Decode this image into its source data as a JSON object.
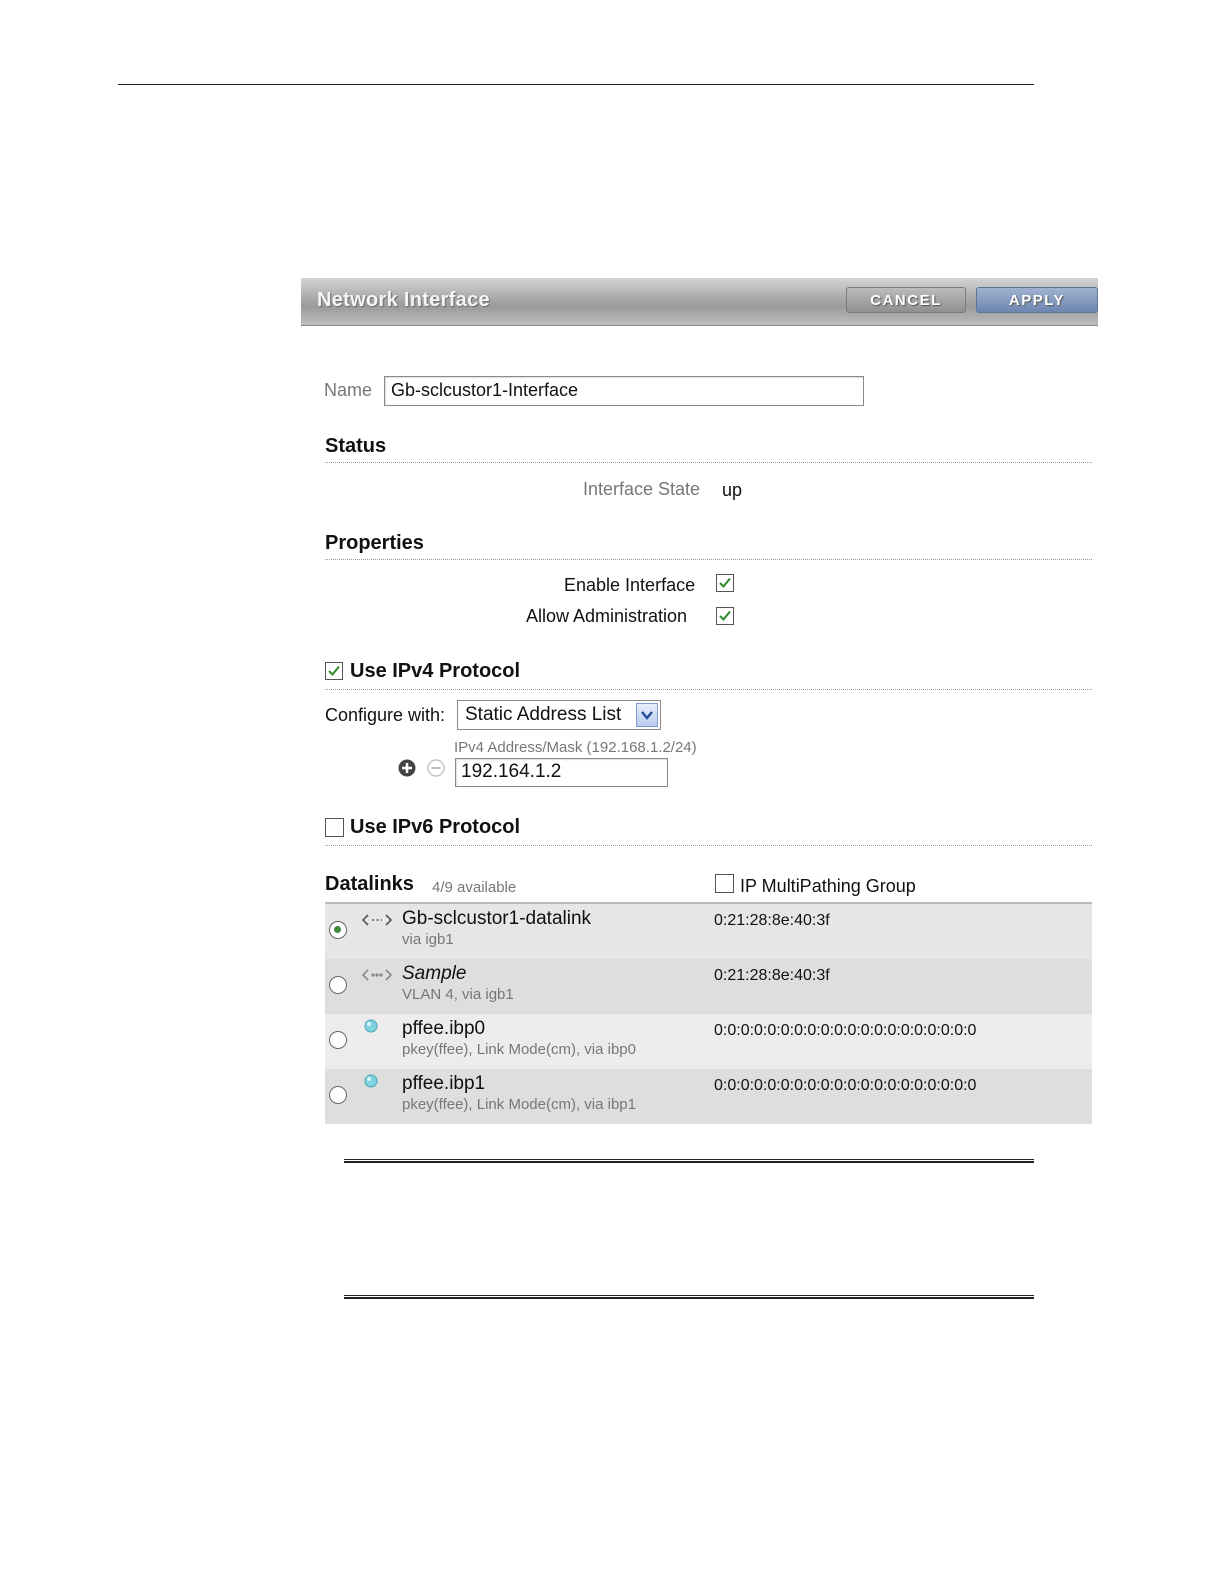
{
  "header": {
    "title": "Network Interface",
    "cancel_label": "CANCEL",
    "apply_label": "APPLY"
  },
  "name_field": {
    "label": "Name",
    "value": "Gb-sclcustor1-Interface"
  },
  "status": {
    "heading": "Status",
    "interface_state_label": "Interface State",
    "interface_state_value": "up"
  },
  "properties": {
    "heading": "Properties",
    "enable_interface_label": "Enable Interface",
    "enable_interface_checked": true,
    "allow_admin_label": "Allow Administration",
    "allow_admin_checked": true
  },
  "ipv4": {
    "heading": "Use IPv4 Protocol",
    "checked": true,
    "configure_label": "Configure with:",
    "configure_value": "Static Address List",
    "address_hint": "IPv4 Address/Mask (192.168.1.2/24)",
    "address_value": "192.164.1.2"
  },
  "ipv6": {
    "heading": "Use IPv6 Protocol",
    "checked": false
  },
  "datalinks": {
    "heading": "Datalinks",
    "available": "4/9 available",
    "ipmp_label": "IP MultiPathing Group",
    "ipmp_checked": false,
    "rows": [
      {
        "name": "Gb-sclcustor1-datalink",
        "sub": "via igb1",
        "mac": "0:21:28:8e:40:3f",
        "selected": true,
        "icon": "datalink-arrows-icon"
      },
      {
        "name": "Sample",
        "sub": "VLAN 4, via igb1",
        "mac": "0:21:28:8e:40:3f",
        "selected": false,
        "icon": "vlan-arrows-icon"
      },
      {
        "name": "pffee.ibp0",
        "sub": "pkey(ffee), Link Mode(cm), via ibp0",
        "mac": "0:0:0:0:0:0:0:0:0:0:0:0:0:0:0:0:0:0:0:0",
        "selected": false,
        "icon": "infiniband-dot-icon"
      },
      {
        "name": "pffee.ibp1",
        "sub": "pkey(ffee), Link Mode(cm), via ibp1",
        "mac": "0:0:0:0:0:0:0:0:0:0:0:0:0:0:0:0:0:0:0:0",
        "selected": false,
        "icon": "infiniband-dot-icon"
      }
    ]
  },
  "colors": {
    "apply_button": "#6d86b0",
    "cancel_button": "#8f8f8f",
    "check_green": "#2e8b2e"
  }
}
